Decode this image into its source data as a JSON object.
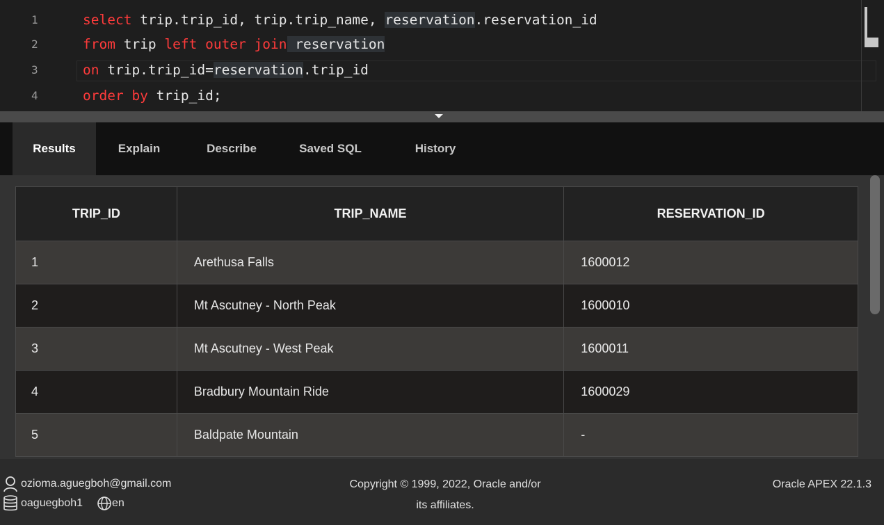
{
  "editor": {
    "lines": [
      {
        "no": "1",
        "t1": "select",
        "t2": " trip.trip_id, trip.trip_name, ",
        "t3": "reservation",
        "t4": ".reservation_id"
      },
      {
        "no": "2",
        "t1": "from",
        "t2": " trip ",
        "t3": "left outer join",
        "t4": " reservation"
      },
      {
        "no": "3",
        "t1": "on",
        "t2": " trip.trip_id=",
        "t3": "reservation",
        "t4": ".trip_id"
      },
      {
        "no": "4",
        "t1": "order by",
        "t2": " trip_id;"
      }
    ]
  },
  "tabs": [
    "Results",
    "Explain",
    "Describe",
    "Saved SQL",
    "History"
  ],
  "results": {
    "columns": [
      "TRIP_ID",
      "TRIP_NAME",
      "RESERVATION_ID"
    ],
    "rows": [
      [
        "1",
        "Arethusa Falls",
        "1600012"
      ],
      [
        "2",
        "Mt Ascutney - North Peak",
        "1600010"
      ],
      [
        "3",
        "Mt Ascutney - West Peak",
        "1600011"
      ],
      [
        "4",
        "Bradbury Mountain Ride",
        "1600029"
      ],
      [
        "5",
        "Baldpate Mountain",
        "-"
      ]
    ]
  },
  "footer": {
    "email": "ozioma.aguegboh@gmail.com",
    "workspace": "oaguegboh1",
    "language": "en",
    "copyright_1": "Copyright © 1999, 2022, Oracle and/or",
    "copyright_2": "its affiliates.",
    "version": "Oracle APEX 22.1.3"
  },
  "icons": {
    "user": "user-icon",
    "database": "database-icon",
    "globe": "globe-icon"
  }
}
